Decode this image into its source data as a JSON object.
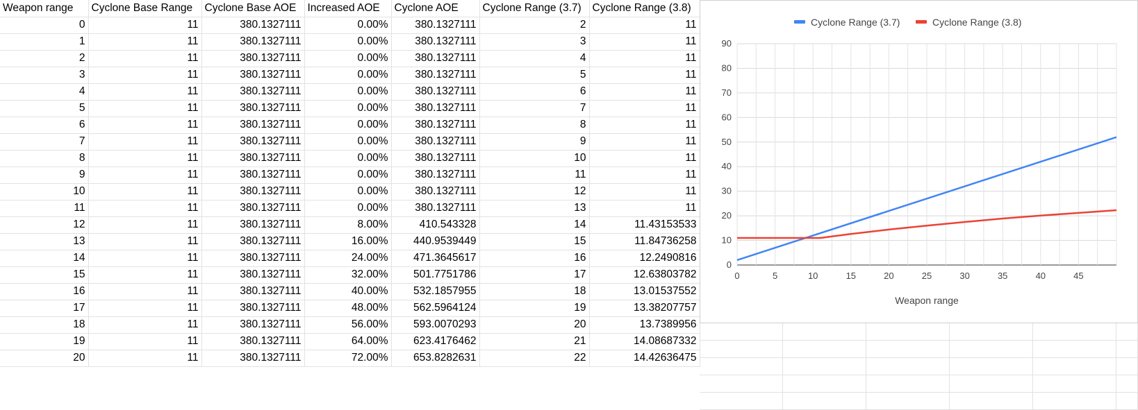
{
  "sheet": {
    "headers": [
      "Weapon range",
      "Cyclone Base Range",
      "Cyclone Base AOE",
      "Increased AOE",
      "Cyclone AOE",
      "Cyclone Range (3.7)",
      "Cyclone Range (3.8)"
    ],
    "rows": [
      [
        "0",
        "11",
        "380.1327111",
        "0.00%",
        "380.1327111",
        "2",
        "11"
      ],
      [
        "1",
        "11",
        "380.1327111",
        "0.00%",
        "380.1327111",
        "3",
        "11"
      ],
      [
        "2",
        "11",
        "380.1327111",
        "0.00%",
        "380.1327111",
        "4",
        "11"
      ],
      [
        "3",
        "11",
        "380.1327111",
        "0.00%",
        "380.1327111",
        "5",
        "11"
      ],
      [
        "4",
        "11",
        "380.1327111",
        "0.00%",
        "380.1327111",
        "6",
        "11"
      ],
      [
        "5",
        "11",
        "380.1327111",
        "0.00%",
        "380.1327111",
        "7",
        "11"
      ],
      [
        "6",
        "11",
        "380.1327111",
        "0.00%",
        "380.1327111",
        "8",
        "11"
      ],
      [
        "7",
        "11",
        "380.1327111",
        "0.00%",
        "380.1327111",
        "9",
        "11"
      ],
      [
        "8",
        "11",
        "380.1327111",
        "0.00%",
        "380.1327111",
        "10",
        "11"
      ],
      [
        "9",
        "11",
        "380.1327111",
        "0.00%",
        "380.1327111",
        "11",
        "11"
      ],
      [
        "10",
        "11",
        "380.1327111",
        "0.00%",
        "380.1327111",
        "12",
        "11"
      ],
      [
        "11",
        "11",
        "380.1327111",
        "0.00%",
        "380.1327111",
        "13",
        "11"
      ],
      [
        "12",
        "11",
        "380.1327111",
        "8.00%",
        "410.543328",
        "14",
        "11.43153533"
      ],
      [
        "13",
        "11",
        "380.1327111",
        "16.00%",
        "440.9539449",
        "15",
        "11.84736258"
      ],
      [
        "14",
        "11",
        "380.1327111",
        "24.00%",
        "471.3645617",
        "16",
        "12.2490816"
      ],
      [
        "15",
        "11",
        "380.1327111",
        "32.00%",
        "501.7751786",
        "17",
        "12.63803782"
      ],
      [
        "16",
        "11",
        "380.1327111",
        "40.00%",
        "532.1857955",
        "18",
        "13.01537552"
      ],
      [
        "17",
        "11",
        "380.1327111",
        "48.00%",
        "562.5964124",
        "19",
        "13.38207757"
      ],
      [
        "18",
        "11",
        "380.1327111",
        "56.00%",
        "593.0070293",
        "20",
        "13.7389956"
      ],
      [
        "19",
        "11",
        "380.1327111",
        "64.00%",
        "623.4176462",
        "21",
        "14.08687332"
      ],
      [
        "20",
        "11",
        "380.1327111",
        "72.00%",
        "653.8282631",
        "22",
        "14.42636475"
      ]
    ]
  },
  "chart_data": {
    "type": "line",
    "title": "",
    "xlabel": "Weapon range",
    "ylabel": "",
    "xlim": [
      0,
      50
    ],
    "ylim": [
      0,
      90
    ],
    "x_ticks": [
      0,
      5,
      10,
      15,
      20,
      25,
      30,
      35,
      40,
      45
    ],
    "y_ticks": [
      0,
      10,
      20,
      30,
      40,
      50,
      60,
      70,
      80,
      90
    ],
    "grid": true,
    "legend_position": "top",
    "series": [
      {
        "name": "Cyclone Range (3.7)",
        "color": "#4285f4",
        "points": [
          [
            0,
            2
          ],
          [
            50,
            52
          ]
        ]
      },
      {
        "name": "Cyclone Range (3.8)",
        "color": "#ea4335",
        "points": [
          [
            0,
            11
          ],
          [
            11,
            11
          ],
          [
            12,
            11.43
          ],
          [
            15,
            12.64
          ],
          [
            20,
            14.43
          ],
          [
            25,
            16.0
          ],
          [
            30,
            17.5
          ],
          [
            35,
            18.9
          ],
          [
            40,
            20.1
          ],
          [
            45,
            21.2
          ],
          [
            50,
            22.3
          ]
        ]
      }
    ]
  }
}
